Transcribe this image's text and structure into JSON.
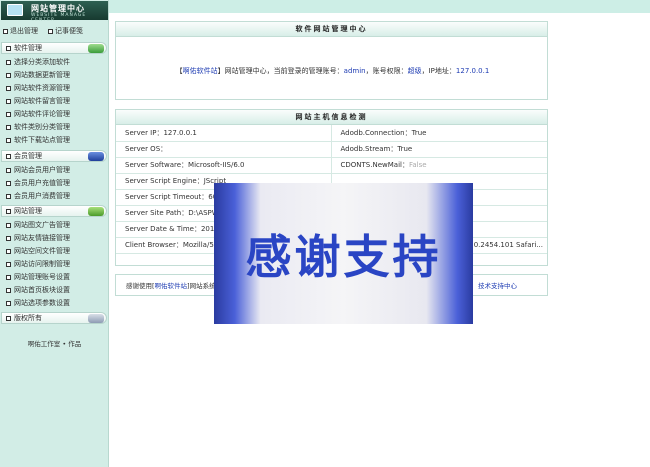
{
  "sidebar": {
    "logo_title": "网站管理中心",
    "logo_subtitle": "WEBSITE MANAGE CENTER",
    "top_links": [
      "退出管理",
      "记事便笺"
    ],
    "sections": [
      {
        "title": "软件管理",
        "items": [
          "选择分类添加软件",
          "网站数据更新管理",
          "网站软件资源管理",
          "网站软件留言管理",
          "网站软件评论管理",
          "软件类别分类管理",
          "软件下载站点管理"
        ]
      },
      {
        "title": "会员管理",
        "items": [
          "网站会员用户管理",
          "会员用户充值管理",
          "会员用户消费管理"
        ]
      },
      {
        "title": "网站管理",
        "items": [
          "网站图文广告管理",
          "网站友情链接管理",
          "网站空间文件管理",
          "网站访问限制管理",
          "网站管理账号设置",
          "网站首页板块设置",
          "网站选项参数设置"
        ]
      },
      {
        "title": "版权所有",
        "items": []
      }
    ],
    "author": "啊佑工作室 • 作品"
  },
  "center_panel": {
    "title": "软件网站管理中心",
    "line_prefix": "【",
    "site_name": "啊佑软件站",
    "line_mid": "】网站管理中心，当前登录的管理账号：",
    "account": "admin",
    "perm_label": "，账号权限：",
    "perm": "超级",
    "ip_label": "，IP地址：",
    "ip": "127.0.0.1"
  },
  "info_panel": {
    "title": "网站主机信息检测",
    "rows": [
      [
        "Server IP：127.0.0.1",
        "Adodb.Connection：True"
      ],
      [
        "Server OS：",
        "Adodb.Stream：True"
      ],
      [
        "Server Software：Microsoft-IIS/6.0",
        "CDONTS.NewMail：False"
      ],
      [
        "Server Script Engine：JScript",
        ""
      ],
      [
        "Server Script Timeout：60",
        ""
      ],
      [
        "Server Site Path：D:\\ASPW",
        ""
      ],
      [
        "Server Date & Time：2015",
        ""
      ],
      [
        "Client Browser：Mozilla/5.0",
        "0.2454.101 Safari..."
      ]
    ]
  },
  "notice": {
    "prefix": "感谢使用[",
    "site": "啊佑软件站",
    "middle": "]网站系统",
    "link": "技术支持中心"
  },
  "overlay_text": "感谢支持"
}
